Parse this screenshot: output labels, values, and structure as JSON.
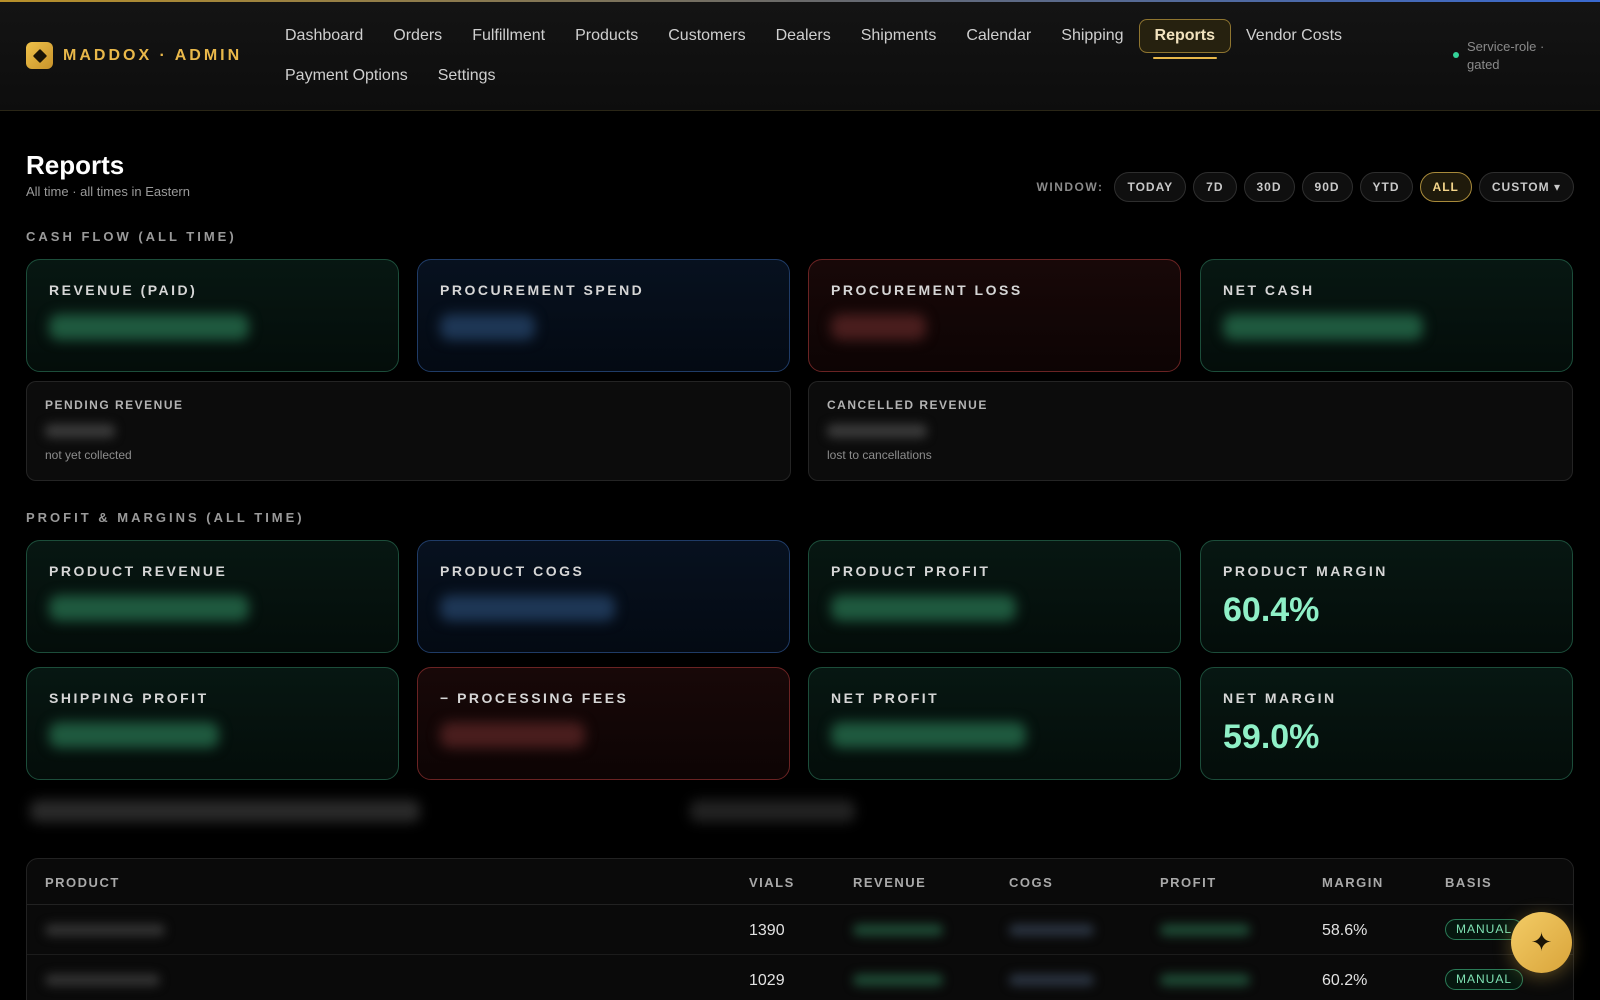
{
  "brand": {
    "name": "MADDOX · ADMIN",
    "logo_icon": "diamond-icon"
  },
  "nav": {
    "items": [
      {
        "label": "Dashboard"
      },
      {
        "label": "Orders"
      },
      {
        "label": "Fulfillment"
      },
      {
        "label": "Products"
      },
      {
        "label": "Customers"
      },
      {
        "label": "Dealers"
      },
      {
        "label": "Shipments"
      },
      {
        "label": "Calendar"
      },
      {
        "label": "Shipping"
      },
      {
        "label": "Reports",
        "active": true
      },
      {
        "label": "Vendor Costs"
      },
      {
        "label": "Payment Options"
      },
      {
        "label": "Settings"
      }
    ]
  },
  "status": {
    "text": "Service-role · gated",
    "color": "#34d399"
  },
  "page": {
    "title": "Reports",
    "subtitle": "All time · all times in Eastern"
  },
  "window": {
    "label": "WINDOW:",
    "options": [
      "TODAY",
      "7D",
      "30D",
      "90D",
      "YTD",
      "ALL",
      "CUSTOM ▾"
    ],
    "selected": "ALL"
  },
  "cash_flow": {
    "heading": "CASH FLOW (ALL TIME)",
    "cards": [
      {
        "label": "REVENUE (PAID)",
        "tone": "green"
      },
      {
        "label": "PROCUREMENT SPEND",
        "tone": "blue"
      },
      {
        "label": "PROCUREMENT LOSS",
        "tone": "red"
      },
      {
        "label": "NET CASH",
        "tone": "green"
      }
    ],
    "pending": {
      "label": "PENDING REVENUE",
      "note": "not yet collected"
    },
    "cancelled": {
      "label": "CANCELLED REVENUE",
      "note": "lost to cancellations"
    }
  },
  "profit": {
    "heading": "PROFIT & MARGINS (ALL TIME)",
    "cards": [
      {
        "label": "PRODUCT REVENUE",
        "tone": "green"
      },
      {
        "label": "PRODUCT COGS",
        "tone": "blue"
      },
      {
        "label": "PRODUCT PROFIT",
        "tone": "green"
      },
      {
        "label": "PRODUCT MARGIN",
        "tone": "green",
        "value": "60.4%"
      },
      {
        "label": "SHIPPING PROFIT",
        "tone": "green"
      },
      {
        "label": "− PROCESSING FEES",
        "tone": "red"
      },
      {
        "label": "NET PROFIT",
        "tone": "green"
      },
      {
        "label": "NET MARGIN",
        "tone": "green",
        "value": "59.0%"
      }
    ]
  },
  "table": {
    "columns": [
      "PRODUCT",
      "VIALS",
      "REVENUE",
      "COGS",
      "PROFIT",
      "MARGIN",
      "BASIS"
    ],
    "rows": [
      {
        "vials": "1390",
        "margin": "58.6%",
        "basis": "MANUAL"
      },
      {
        "vials": "1029",
        "margin": "60.2%",
        "basis": "MANUAL"
      }
    ]
  },
  "fab": {
    "icon": "sparkle-icon",
    "glyph": "✦"
  }
}
